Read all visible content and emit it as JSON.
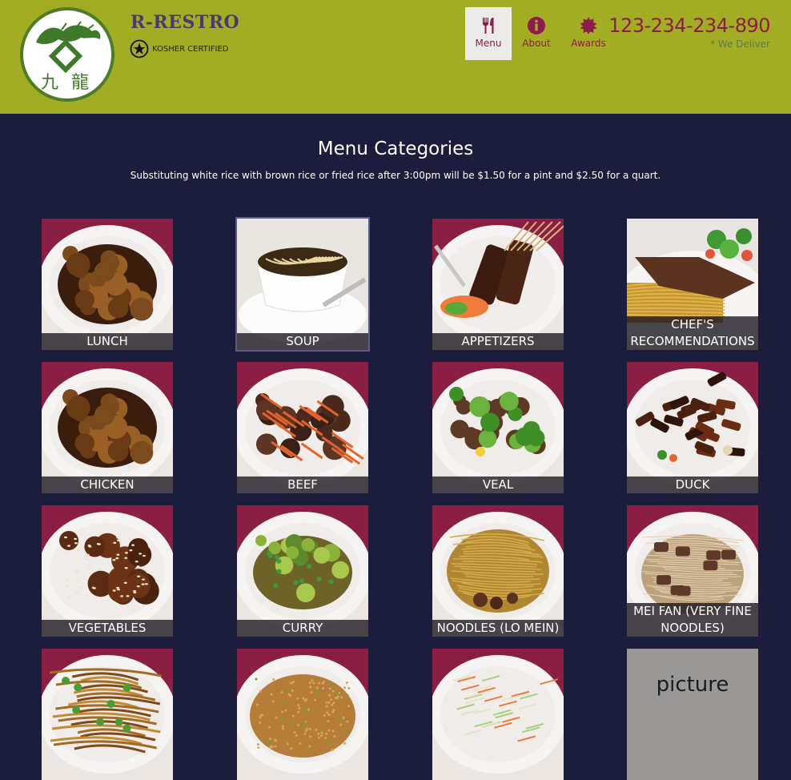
{
  "header": {
    "brand_name": "R-RESTRO",
    "logo_text": "九龍",
    "kosher_label": "KOSHER CERTIFIED",
    "nav": [
      {
        "label": "Menu",
        "icon": "fork-knife-icon",
        "active": true
      },
      {
        "label": "About",
        "icon": "info-icon",
        "active": false
      },
      {
        "label": "Awards",
        "icon": "award-badge-icon",
        "active": false
      }
    ],
    "phone": "123-234-234-890",
    "deliver_note": "* We Deliver"
  },
  "main": {
    "title": "Menu Categories",
    "note": "Substituting white rice with brown rice or fried rice after 3:00pm will be $1.50 for a pint and $2.50 for a quart."
  },
  "categories": [
    {
      "label": "LUNCH",
      "dish": "orange-chicken"
    },
    {
      "label": "SOUP",
      "dish": "noodle-soup"
    },
    {
      "label": "APPETIZERS",
      "dish": "skewers"
    },
    {
      "label": "CHEF'S RECOMMENDATIONS",
      "dish": "steak-noodles"
    },
    {
      "label": "CHICKEN",
      "dish": "orange-chicken"
    },
    {
      "label": "BEEF",
      "dish": "beef-carrot"
    },
    {
      "label": "VEAL",
      "dish": "broccoli-veal"
    },
    {
      "label": "DUCK",
      "dish": "duck"
    },
    {
      "label": "VEGETABLES",
      "dish": "sesame"
    },
    {
      "label": "CURRY",
      "dish": "curry"
    },
    {
      "label": "NOODLES (LO MEIN)",
      "dish": "lo-mein"
    },
    {
      "label": "MEI FAN (VERY FINE NOODLES)",
      "dish": "mei-fan"
    },
    {
      "label": "",
      "dish": "chow-fun"
    },
    {
      "label": "",
      "dish": "fried-rice"
    },
    {
      "label": "",
      "dish": "slaw"
    },
    {
      "label": "",
      "dish": "placeholder",
      "placeholder_text": "picture"
    }
  ],
  "colors": {
    "header_bg": "#a3ad23",
    "page_bg": "#1c1d3d",
    "accent": "#8d1c4d",
    "brand": "#4a3a72"
  }
}
